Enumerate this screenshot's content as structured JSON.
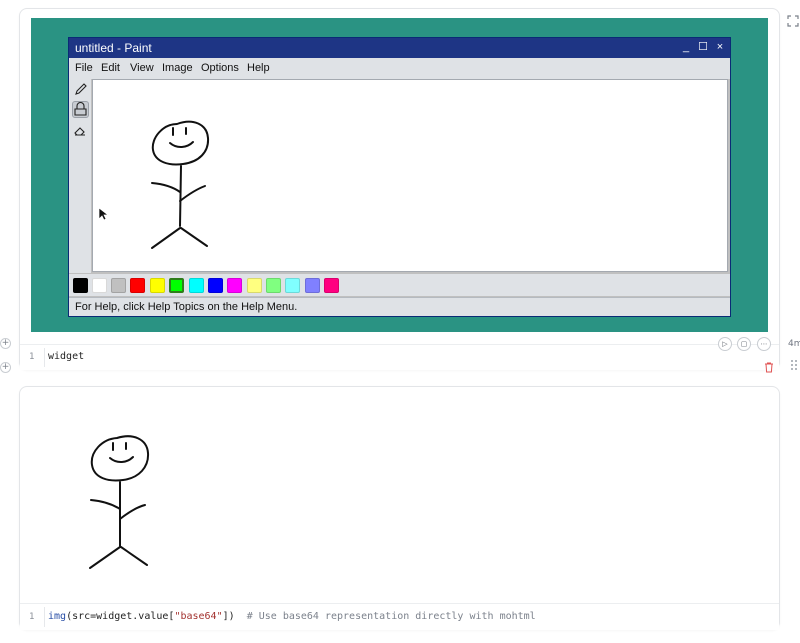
{
  "paint": {
    "title": "untitled - Paint",
    "window_buttons": {
      "minimize": "_",
      "maximize": "☐",
      "close": "×"
    },
    "menu": [
      "File",
      "Edit",
      "View",
      "Image",
      "Options",
      "Help"
    ],
    "tools": [
      {
        "name": "pencil-icon",
        "active": false
      },
      {
        "name": "paint-bucket-icon",
        "active": true
      },
      {
        "name": "eraser-icon",
        "active": false
      }
    ],
    "palette": [
      "#000000",
      "#ffffff",
      "#c0c0c0",
      "#ff0000",
      "#ffff00",
      "#00ff00",
      "#00ffff",
      "#0000ff",
      "#ff00ff",
      "#ffff80",
      "#80ff80",
      "#80ffff",
      "#8080ff",
      "#ff0080"
    ],
    "selected_color_index": 5,
    "status": "For Help, click Help Topics on the Help Menu."
  },
  "cell1": {
    "line_number": "1",
    "code": "widget",
    "elapsed": "4m"
  },
  "cell2": {
    "line_number": "1",
    "code": {
      "fn": "img",
      "p1": "(src=widget.value[",
      "str": "\"base64\"",
      "p2": "])",
      "comment": "# Use base64 representation directly with mohtml"
    }
  },
  "icons": {
    "expand": "expand-icon",
    "add_cell": "plus-icon",
    "run": "play-icon",
    "stop": "stop-icon",
    "more": "more-icon",
    "delete": "trash-icon",
    "drag": "drag-handle-icon"
  }
}
